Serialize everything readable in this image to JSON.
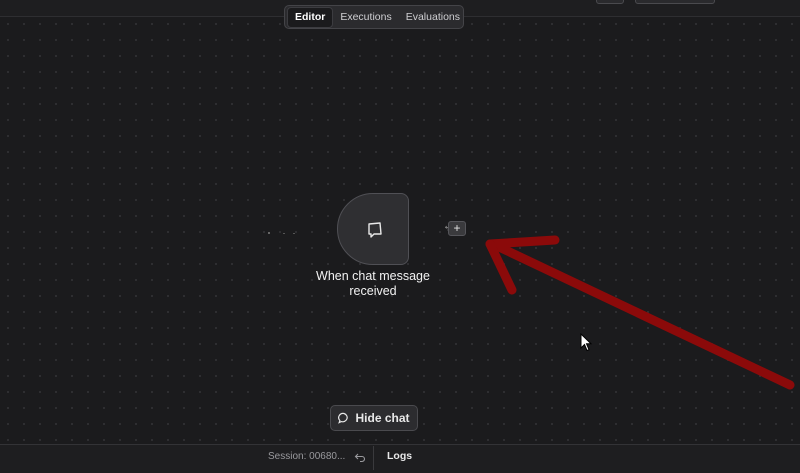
{
  "tabs": [
    {
      "label": "Editor",
      "active": true
    },
    {
      "label": "Executions",
      "active": false
    },
    {
      "label": "Evaluations",
      "active": false
    }
  ],
  "node": {
    "label": "When chat message received",
    "icon": "chat-bubble-icon"
  },
  "canvas": {
    "add_button_label": "+"
  },
  "chat_toggle": {
    "label": "Hide chat",
    "icon": "chat-icon"
  },
  "footer": {
    "session_text": "Session: 00680...",
    "logs_label": "Logs"
  },
  "colors": {
    "background": "#1b1b1d",
    "arrow": "#8b0a0a",
    "node_fill": "#2f2f32"
  }
}
